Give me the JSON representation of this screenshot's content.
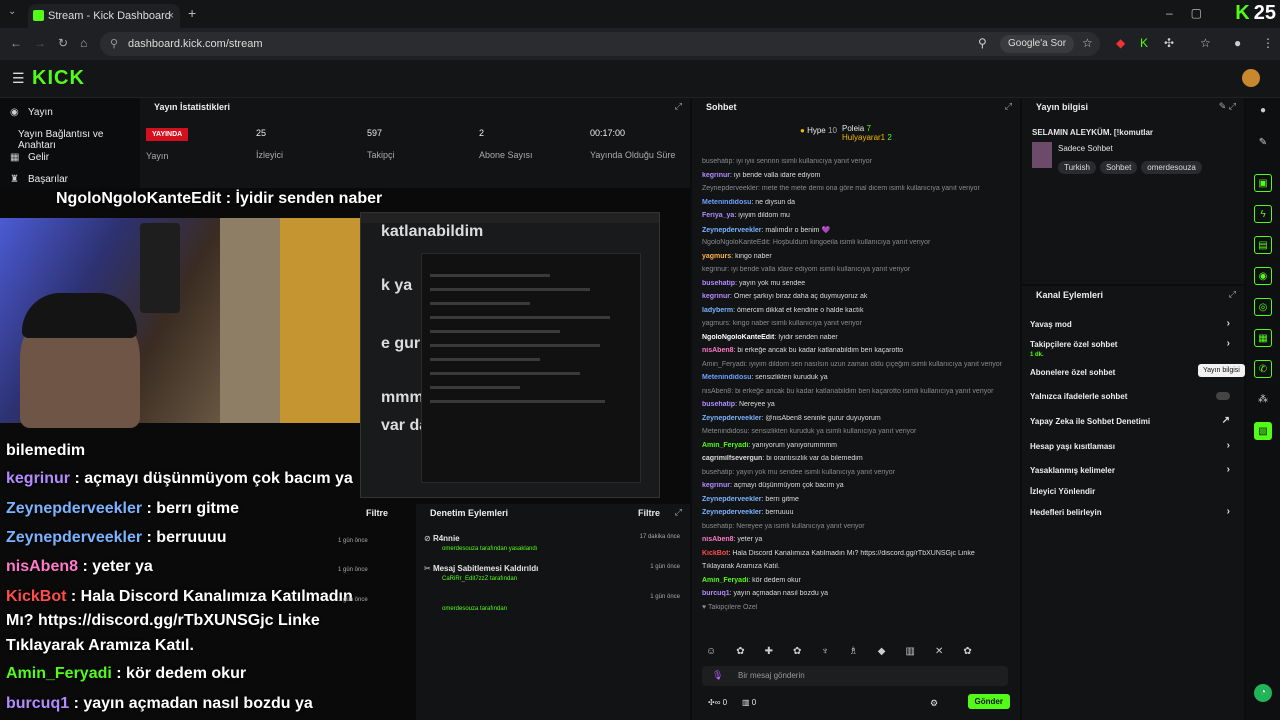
{
  "browser": {
    "tab_title": "Stream - Kick Dashboard",
    "url": "dashboard.kick.com/stream",
    "google_btn": "Google'a Sor",
    "kick_count": "25"
  },
  "app": {
    "logo": "KICK"
  },
  "sidebar": {
    "items": [
      {
        "label": "Yayın"
      },
      {
        "label": "Yayın Bağlantısı ve Anahtarı"
      },
      {
        "label": "Gelir"
      },
      {
        "label": "Başarılar"
      }
    ]
  },
  "stats": {
    "title": "Yayın İstatistikleri",
    "live_badge": "YAYINDA",
    "items": [
      {
        "value": "",
        "label": "Yayın"
      },
      {
        "value": "25",
        "label": "İzleyici"
      },
      {
        "value": "597",
        "label": "Takipçi"
      },
      {
        "value": "2",
        "label": "Abone Sayısı"
      },
      {
        "value": "00:17:00",
        "label": "Yayında Olduğu Süre"
      }
    ]
  },
  "overlay": {
    "top_line": "NgoloNgoloKanteEdit : İyidir senden naber",
    "partial1": "katlanabildim",
    "partial2": "k ya",
    "partial3": "e gurur",
    "partial4": "mmm",
    "partial5": "var da",
    "lines": [
      {
        "text": "bilemedim"
      },
      {
        "user": "kegrinur",
        "text": ": açmayı düşünmüyom çok bacım ya"
      },
      {
        "user": "Zeynepderveekler",
        "text": ": berrı gitme"
      },
      {
        "user": "Zeynepderveekler",
        "text": ": berruuuu"
      },
      {
        "user": "nisAben8",
        "text": ": yeter ya"
      },
      {
        "user": "KickBot",
        "text": ": Hala Discord Kanalımıza Katılmadın"
      },
      {
        "text": "Mı? https://discord.gg/rTbXUNSGjc Linke"
      },
      {
        "text": "Tıklayarak Aramıza Katıl."
      },
      {
        "user": "Amin_Feryadi",
        "text": ": kör dedem okur"
      },
      {
        "user": "burcuq1",
        "text": ": yayın açmadan nasıl bozdu ya"
      }
    ]
  },
  "chat": {
    "title": "Sohbet",
    "hype_label": "Hype",
    "hype_count": "10",
    "top1": "Poleia",
    "top1_count": "7",
    "top2": "Hulyayarar1",
    "top2_count": "2",
    "messages": [
      {
        "sys": true,
        "text": "busehatip: iyi iyiii sennnn isimli kullanıcıya yanıt veriyor"
      },
      {
        "user": "kegrinur",
        "color": "#b28cff",
        "text": ": iyi bende valla idare ediyom"
      },
      {
        "sys": true,
        "text": "Zeynepderveekler: mete the mete demi ona göre mal dicem isimli kullanıcıya yanıt veriyor"
      },
      {
        "user": "Metenindidosu",
        "color": "#6ea0ff",
        "text": ": ne diysun da"
      },
      {
        "user": "Feriya_ya",
        "color": "#b28cff",
        "text": ": iyiyim dildom mu"
      },
      {
        "user": "Zeynepderveekler",
        "color": "#7ab3ff",
        "text": ": malımdır o benim 💜"
      },
      {
        "sys": true,
        "text": "NgoloNgoloKanteEdit: Hoşbuldum kingoeila isimli kullanıcıya yanıt veriyor"
      },
      {
        "user": "yagmurs",
        "color": "#ffb14a",
        "text": ": kingo naber"
      },
      {
        "sys": true,
        "text": "kegrinur: iyi bende valla idare ediyom isimli kullanıcıya yanıt veriyor"
      },
      {
        "user": "busehatip",
        "color": "#b28cff",
        "text": ": yayın yok mu sendee"
      },
      {
        "user": "kegrinur",
        "color": "#b28cff",
        "text": ": Ömer şarkıyı biraz daha aç duymuyoruz ak"
      },
      {
        "user": "ladyberm",
        "color": "#7ab3ff",
        "text": ": ömercim dikkat et kendine o halde kactık"
      },
      {
        "sys": true,
        "text": "yagmurs: kingo naber isimli kullanıcıya yanıt veriyor"
      },
      {
        "user": "NgoloNgoloKanteEdit",
        "color": "#ffffff",
        "text": ": İyidir senden naber"
      },
      {
        "user": "nisAben8",
        "color": "#ff7ac8",
        "text": ": bi erkeğe ancak bu kadar katlanabildim ben kaçarotto"
      },
      {
        "sys": true,
        "text": "Amin_Feryadi: iyiyim dildom sen nasılsın uzun zaman oldu çiçeğim isimli kullanıcıya yanıt veriyor"
      },
      {
        "user": "Metenindidosu",
        "color": "#6ea0ff",
        "text": ": sensizlikten kuruduk ya"
      },
      {
        "sys": true,
        "text": "nisAben8: bi erkeğe ancak bu kadar katlanabildim ben kaçarotto isimli kullanıcıya yanıt veriyor"
      },
      {
        "user": "busehatip",
        "color": "#b28cff",
        "text": ": Nereyee ya"
      },
      {
        "user": "Zeynepderveekler",
        "color": "#7ab3ff",
        "text": ": @nisAben8 seninle gurur duyuyorum"
      },
      {
        "sys": true,
        "text": "Metenindidosu: sensizlikten kuruduk ya isimli kullanıcıya yanıt veriyor"
      },
      {
        "user": "Amin_Feryadi",
        "color": "#53fc18",
        "text": ": yanıyorum yanıyorummmm"
      },
      {
        "user": "cagrimilfsevergun",
        "color": "#ddd",
        "text": ": bi orantısızlık var da bilemedim"
      },
      {
        "sys": true,
        "text": "busehatip: yayın yok mu sendee isimli kullanıcıya yanıt veriyor"
      },
      {
        "user": "kegrinur",
        "color": "#b28cff",
        "text": ": açmayı düşünmüyom çok bacım ya"
      },
      {
        "user": "Zeynepderveekler",
        "color": "#7ab3ff",
        "text": ": berrı gitme"
      },
      {
        "user": "Zeynepderveekler",
        "color": "#7ab3ff",
        "text": ": berruuuu"
      },
      {
        "sys": true,
        "text": "busehatip: Nereyee ya isimli kullanıcıya yanıt veriyor"
      },
      {
        "user": "nisAben8",
        "color": "#ff7ac8",
        "text": ": yeter ya"
      },
      {
        "user": "KickBot",
        "color": "#ff4d4d",
        "text": ": Hala Discord Kanalımıza Katılmadın Mı? https://discord.gg/rTbXUNSGjc Linke"
      },
      {
        "text": "Tıklayarak Aramıza Katıl."
      },
      {
        "user": "Amin_Feryadi",
        "color": "#53fc18",
        "text": ": kör dedem okur"
      },
      {
        "user": "burcuq1",
        "color": "#b28cff",
        "text": ": yayın açmadan nasıl bozdu ya"
      },
      {
        "sys": true,
        "text": "♥ Takipçilere Özel"
      }
    ],
    "input_placeholder": "Bir mesaj gönderin",
    "send_label": "Gönder",
    "footer_count1": "0",
    "footer_count2": "0"
  },
  "info": {
    "title": "Yayın bilgisi",
    "stream_title": "SELAMIN ALEYKÜM. [!komutlar",
    "category": "Sadece Sohbet",
    "tags": [
      "Turkish",
      "Sohbet",
      "omerdesouza"
    ]
  },
  "channel_actions": {
    "title": "Kanal Eylemleri",
    "items": [
      {
        "label": "Yavaş mod"
      },
      {
        "label": "Takipçilere özel sohbet",
        "sub": "1 dk."
      },
      {
        "label": "Abonelere özel sohbet"
      },
      {
        "label": "Yalnızca ifadelerle sohbet"
      },
      {
        "label": "Yapay Zeka ile Sohbet Denetimi"
      },
      {
        "label": "Hesap yaşı kısıtlaması"
      },
      {
        "label": "Yasaklanmış kelimeler"
      },
      {
        "label": "İzleyici Yönlendir"
      },
      {
        "label": "Hedefleri belirleyin"
      }
    ],
    "tooltip": "Yayın bilgisi"
  },
  "mod": {
    "title": "Denetim Eylemleri",
    "filter": "Filtre",
    "left_filter": "Filtre",
    "rows": [
      {
        "name": "R4nnie",
        "sub": "omerdesouza tarafından yasaklandı",
        "time": "17 dakika önce"
      },
      {
        "name": "Mesaj Sabitlemesi Kaldırıldı",
        "sub": "CaRiRr_Edit7zzZ tarafından",
        "time": "1 gün önce"
      },
      {
        "name": "",
        "sub": "omerdesouza tarafından",
        "time": "1 gün önce"
      }
    ],
    "left_times": [
      "1 gün önce",
      "1 gün önce",
      "1 gün önce"
    ]
  }
}
